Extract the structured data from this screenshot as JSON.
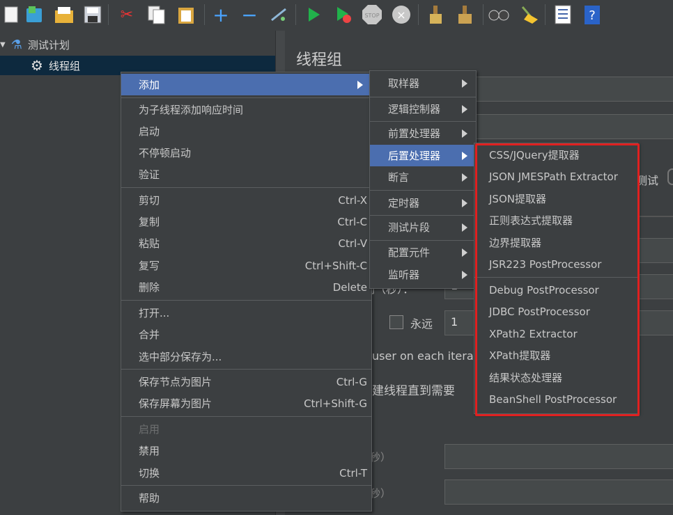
{
  "toolbar": {
    "icons": [
      "new-icon",
      "templates-icon",
      "open-icon",
      "save-icon",
      "cut-icon",
      "copy-icon",
      "paste-icon",
      "expand-icon",
      "collapse-icon",
      "toggle-icon",
      "start-icon",
      "start-no-pause-icon",
      "stop-icon",
      "shutdown-icon",
      "clear-icon",
      "clear-all-icon",
      "search-icon",
      "reset-search-icon",
      "function-helper-icon",
      "help-icon"
    ]
  },
  "tree": {
    "test_plan": "测试计划",
    "thread_group": "线程组"
  },
  "panel": {
    "title": "线程组",
    "loop_forever": "永远",
    "loop_value": "1",
    "ramp_value": "1",
    "same_user_text": "user on each iterati",
    "delay_text": "建线程直到需要",
    "partial_test": "测试",
    "partial_seconds": "间（秒）：",
    "partial_sec1": "秒）",
    "partial_sec2": "秒）"
  },
  "context_menu": {
    "add": "添加",
    "add_response_time": "为子线程添加响应时间",
    "start": "启动",
    "start_no_pause": "不停顿启动",
    "validate": "验证",
    "cut": "剪切",
    "cut_key": "Ctrl-X",
    "copy": "复制",
    "copy_key": "Ctrl-C",
    "paste": "粘贴",
    "paste_key": "Ctrl-V",
    "duplicate": "复写",
    "duplicate_key": "Ctrl+Shift-C",
    "remove": "删除",
    "remove_key": "Delete",
    "open": "打开...",
    "merge": "合并",
    "save_selection": "选中部分保存为...",
    "save_node_image": "保存节点为图片",
    "save_node_image_key": "Ctrl-G",
    "save_screen_image": "保存屏幕为图片",
    "save_screen_image_key": "Ctrl+Shift-G",
    "enable": "启用",
    "disable": "禁用",
    "toggle": "切换",
    "toggle_key": "Ctrl-T",
    "help": "帮助"
  },
  "add_submenu": [
    "取样器",
    "逻辑控制器",
    "前置处理器",
    "后置处理器",
    "断言",
    "定时器",
    "测试片段",
    "配置元件",
    "监听器"
  ],
  "post_processors": {
    "group1": [
      "CSS/JQuery提取器",
      "JSON JMESPath Extractor",
      "JSON提取器",
      "正则表达式提取器",
      "边界提取器",
      "JSR223 PostProcessor"
    ],
    "group2": [
      "Debug PostProcessor",
      "JDBC PostProcessor",
      "XPath2 Extractor",
      "XPath提取器",
      "结果状态处理器",
      "BeanShell PostProcessor"
    ]
  },
  "colors": {
    "background": "#3c3f41",
    "selection": "#4b6eaf",
    "highlight_box": "#e02020"
  }
}
